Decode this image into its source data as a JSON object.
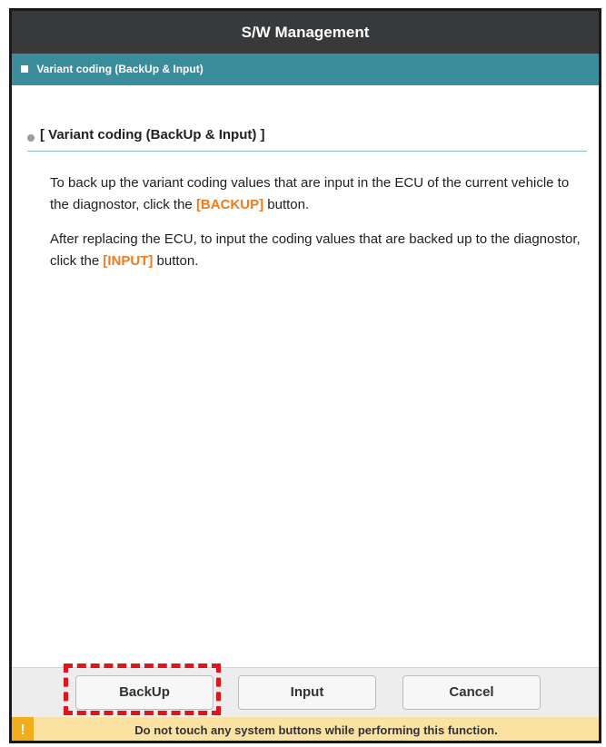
{
  "window": {
    "title": "S/W Management"
  },
  "subheader": {
    "label": "Variant coding (BackUp & Input)"
  },
  "section": {
    "title": "[ Variant coding (BackUp & Input) ]"
  },
  "paragraphs": [
    {
      "before": "To back up the variant coding values that are input in the ECU of the current vehicle to the diagnostor, click the ",
      "highlight": "[BACKUP]",
      "after": " button."
    },
    {
      "before": "After replacing the ECU, to input the coding values that are backed up to the diagnostor, click the ",
      "highlight": "[INPUT]",
      "after": " button."
    }
  ],
  "buttons": {
    "backup": "BackUp",
    "input": "Input",
    "cancel": "Cancel"
  },
  "warning": {
    "icon": "!",
    "text": "Do not touch any system buttons while performing this function."
  },
  "colors": {
    "title_bar": "#38393b",
    "sub_bar": "#3b8d9b",
    "highlight_text": "#f07a1c",
    "annotation_box": "#e0151b",
    "warning_bar": "#fbe2a3",
    "warning_icon": "#f2ad1b"
  }
}
